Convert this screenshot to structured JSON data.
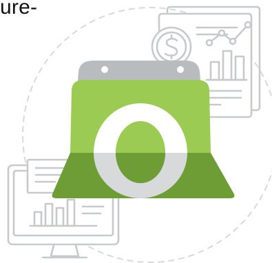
{
  "headline": {
    "text": "ure-"
  },
  "illustration": {
    "subject": "office-suite-app-icon-with-finance-report-and-desktop-analytics",
    "colors": {
      "green_light": "#9bcb52",
      "green_dark": "#6f9d35",
      "gray_frame": "#b9bcbf",
      "gray_line": "#c7c9cc",
      "white_ring": "#ffffff",
      "ring_lower": "#d7d9db",
      "dashed_circle": "#d9d9d9"
    },
    "icons": [
      "dollar-coin-icon",
      "growth-line-chart-icon",
      "bar-chart-icon",
      "report-document-icon",
      "desktop-monitor-icon",
      "app-bag-icon"
    ]
  }
}
